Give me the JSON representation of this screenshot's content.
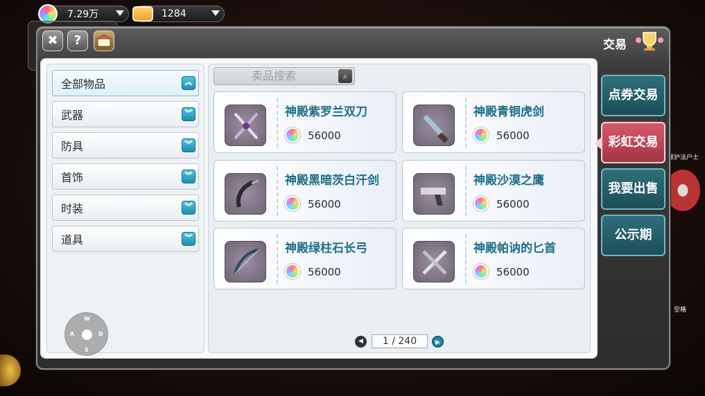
{
  "currency": {
    "rainbow_amount": "7.29万",
    "ticket_amount": "1284"
  },
  "window": {
    "title": "交易",
    "close_label": "✖",
    "help_label": "?"
  },
  "search": {
    "placeholder": "卖品搜索"
  },
  "categories": [
    {
      "label": "全部物品",
      "expanded": true
    },
    {
      "label": "武器",
      "expanded": false
    },
    {
      "label": "防具",
      "expanded": false
    },
    {
      "label": "首饰",
      "expanded": false
    },
    {
      "label": "时装",
      "expanded": false
    },
    {
      "label": "道具",
      "expanded": false
    }
  ],
  "items": [
    {
      "name": "神殿紫罗兰双刀",
      "price": "56000",
      "icon": "twin-blades-icon"
    },
    {
      "name": "神殿青铜虎剑",
      "price": "56000",
      "icon": "bronze-sword-icon"
    },
    {
      "name": "神殿黑暗茨白汗剑",
      "price": "56000",
      "icon": "dark-sword-icon"
    },
    {
      "name": "神殿沙漠之鹰",
      "price": "56000",
      "icon": "pistol-icon"
    },
    {
      "name": "神殿绿柱石长弓",
      "price": "56000",
      "icon": "longbow-icon"
    },
    {
      "name": "神殿帕讷的匕首",
      "price": "56000",
      "icon": "dagger-icon"
    }
  ],
  "pager": {
    "text": "1 / 240"
  },
  "tabs": [
    {
      "label": "点券交易",
      "active": false
    },
    {
      "label": "彩虹交易",
      "active": true
    },
    {
      "label": "我要出售",
      "active": false
    },
    {
      "label": "公示期",
      "active": false
    }
  ],
  "joystick": {
    "up": "W",
    "left": "A",
    "right": "D",
    "down": "S"
  },
  "side_text": {
    "space_label": "空格",
    "snippet": "球护法户士"
  },
  "colors": {
    "item_name": "#1e6e8a",
    "active_tab": "#a53445",
    "tab": "#1d4e57"
  }
}
